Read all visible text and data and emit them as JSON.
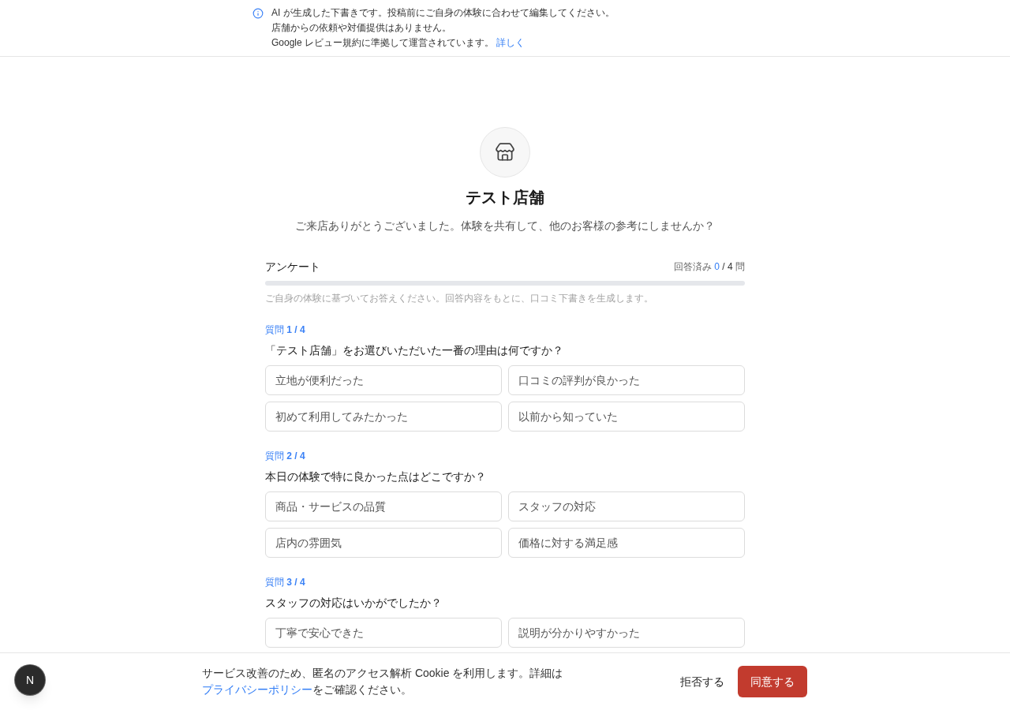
{
  "notice": {
    "lines": [
      {
        "text": "AI が生成した下書きです。投稿前にご自身の体験に合わせて編集してください。"
      },
      {
        "text": "店舗からの依頼や対価提供はありません。"
      },
      {
        "text": "Google レビュー規約に準拠して運営されています。",
        "link": "詳しく"
      }
    ]
  },
  "store": {
    "name": "テスト店舗",
    "greeting": "ご来店ありがとうございました。体験を共有して、他のお客様の参考にしませんか？"
  },
  "survey": {
    "title": "アンケート",
    "progress": {
      "label": "回答済み",
      "answered": "0",
      "total": "/ 4",
      "unit": "問",
      "level": 0
    },
    "hint": "ご自身の体験に基づいてお答えください。回答内容をもとに、口コミ下書きを生成します。"
  },
  "questions": [
    {
      "number": "質問 **1 / 4**",
      "text": "「テスト店舗」をお選びいただいた一番の理由は何ですか？",
      "options": [
        {
          "label": "立地が便利だった",
          "selected": false
        },
        {
          "label": "口コミの評判が良かった",
          "selected": false
        },
        {
          "label": "初めて利用してみたかった",
          "selected": false
        },
        {
          "label": "以前から知っていた",
          "selected": false
        }
      ]
    },
    {
      "number": "質問 **2 / 4**",
      "text": "本日の体験で特に良かった点はどこですか？",
      "options": [
        {
          "label": "商品・サービスの品質",
          "selected": false
        },
        {
          "label": "スタッフの対応",
          "selected": false
        },
        {
          "label": "店内の雰囲気",
          "selected": false
        },
        {
          "label": "価格に対する満足感",
          "selected": false
        }
      ]
    },
    {
      "number": "質問 **3 / 4**",
      "text": "スタッフの対応はいかがでしたか？",
      "options": [
        {
          "label": "丁寧で安心できた",
          "selected": false
        },
        {
          "label": "説明が分かりやすかった",
          "selected": false
        }
      ]
    }
  ],
  "cookie_banner": {
    "text_before": "サービス改善のため、匿名のアクセス解析 Cookie を利用します。詳細は ",
    "link": "プライバシーポリシー",
    "text_after": "をご確認ください。",
    "buttons": [
      {
        "label": "拒否する",
        "kind": "secondary"
      },
      {
        "label": "同意する",
        "kind": "primary"
      }
    ]
  },
  "dev_badge": {
    "label": "N"
  }
}
